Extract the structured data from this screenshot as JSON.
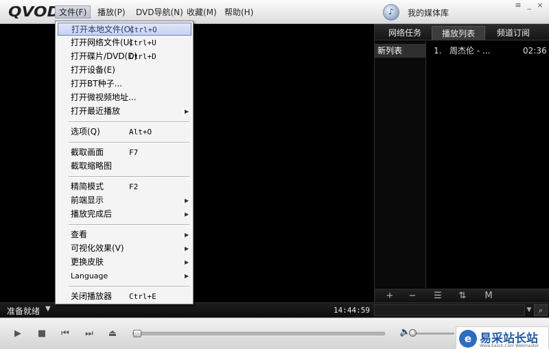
{
  "app": {
    "logo": "QVOD",
    "menu": [
      {
        "label": "文件(F)"
      },
      {
        "label": "播放(P)"
      },
      {
        "label": "DVD导航(N)"
      },
      {
        "label": "收藏(M)"
      },
      {
        "label": "帮助(H)"
      }
    ],
    "library_label": "我的媒体库",
    "library_icon": "music-note-icon",
    "window_controls": [
      "≡",
      "_",
      "×"
    ]
  },
  "file_menu": {
    "items": [
      {
        "label": "打开本地文件(O)",
        "shortcut": "Ctrl+O",
        "highlighted": true
      },
      {
        "label": "打开网络文件(U)",
        "shortcut": "Ctrl+U"
      },
      {
        "label": "打开碟片/DVD(D)",
        "shortcut": "Ctrl+D"
      },
      {
        "label": "打开设备(E)",
        "shortcut": ""
      },
      {
        "label": "打开BT种子...",
        "shortcut": ""
      },
      {
        "label": "打开微视频地址...",
        "shortcut": ""
      },
      {
        "label": "打开最近播放",
        "shortcut": "",
        "submenu": true
      },
      {
        "label": "选项(Q)",
        "shortcut": "Alt+O"
      },
      {
        "label": "截取画面",
        "shortcut": "F7"
      },
      {
        "label": "截取缩略图",
        "shortcut": ""
      },
      {
        "label": "精简模式",
        "shortcut": "F2"
      },
      {
        "label": "前端显示",
        "shortcut": "",
        "submenu": true
      },
      {
        "label": "播放完成后",
        "shortcut": "",
        "submenu": true
      },
      {
        "label": "查看",
        "shortcut": "",
        "submenu": true
      },
      {
        "label": "可视化效果(V)",
        "shortcut": "",
        "submenu": true
      },
      {
        "label": "更换皮肤",
        "shortcut": "",
        "submenu": true
      },
      {
        "label": "Language",
        "shortcut": "",
        "submenu": true
      },
      {
        "label": "关闭播放器",
        "shortcut": "Ctrl+E"
      }
    ],
    "submenu_arrow": "▶"
  },
  "right_panel": {
    "tabs": [
      {
        "label": "网络任务"
      },
      {
        "label": "播放列表",
        "active": true
      },
      {
        "label": "频道订阅"
      }
    ],
    "list_name": "新列表",
    "playlist": [
      {
        "index": "1.",
        "title": "周杰伦 - ...",
        "duration": "02:36"
      }
    ],
    "bottom_buttons": [
      {
        "icon": "add-icon",
        "glyph": "+"
      },
      {
        "icon": "remove-icon",
        "glyph": "−"
      },
      {
        "icon": "list-icon",
        "glyph": "☰"
      },
      {
        "icon": "sort-icon",
        "glyph": "⇅"
      },
      {
        "icon": "mode-icon",
        "glyph": "M"
      }
    ]
  },
  "status": {
    "text": "准备就绪",
    "time": "14:44:59"
  },
  "controls": {
    "play": "▶",
    "stop": "■",
    "prev": "⏮",
    "next": "⏭",
    "eject": "⏏",
    "volume_icon": "🔈",
    "seek_position": 0,
    "volume_level": 0.0
  },
  "watermark": {
    "logo": "e",
    "text": "易采站长站",
    "sub": "Www.Easck.Com Webmaster"
  },
  "colors": {
    "menu_highlight": "#c6d2ee",
    "background": "#000000",
    "panel_tab_active": "#3c3c3c",
    "brand_blue": "#1d58ad"
  }
}
